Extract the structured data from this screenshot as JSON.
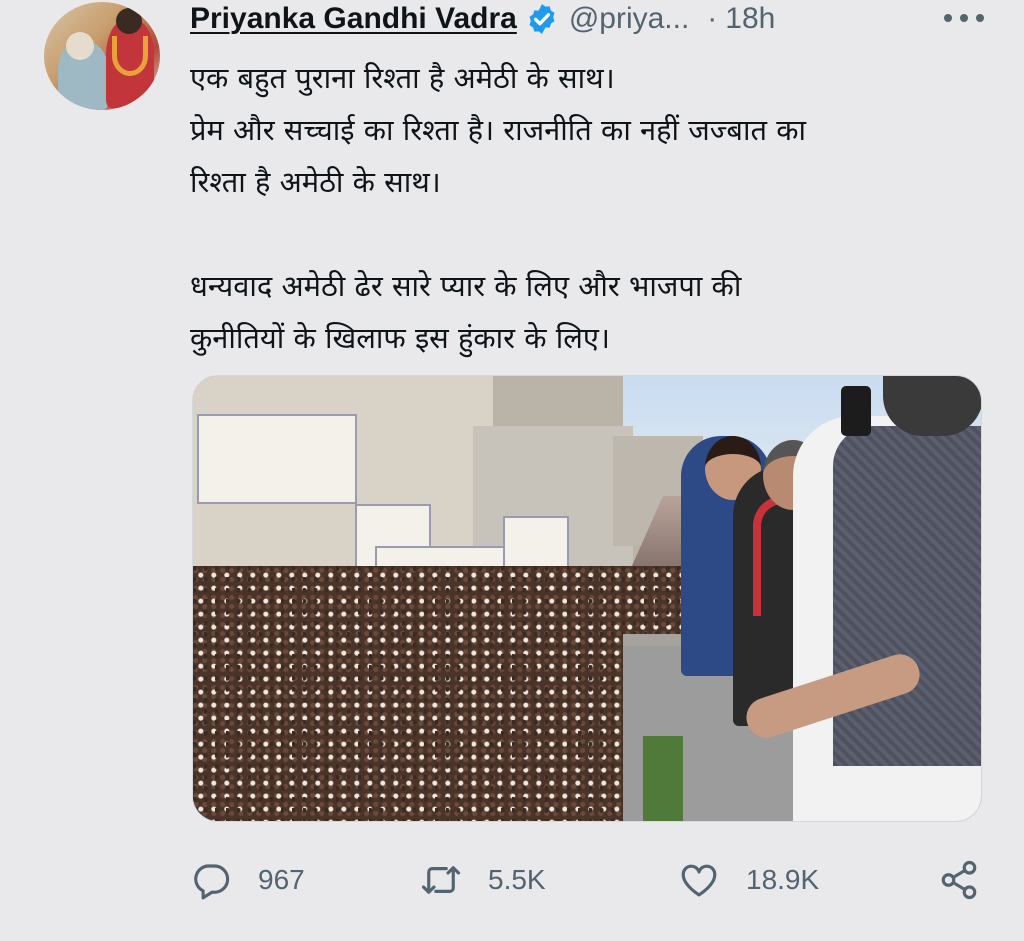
{
  "author": {
    "name": "Priyanka Gandhi Vadra",
    "handle": "@priya...",
    "separator": "·",
    "time": "18h",
    "verified": true
  },
  "tweet_text": {
    "line1": "एक बहुत पुराना रिश्ता है अमेठी के साथ।",
    "line2": "प्रेम और सच्चाई का रिश्ता है। राजनीति का नहीं जज्बात का",
    "line3": "रिश्ता है अमेठी के साथ।",
    "line4": "धन्यवाद अमेठी ढेर सारे प्यार के लिए और भाजपा की",
    "line5": "कुनीतियों के खिलाफ इस हुंकार के लिए।"
  },
  "metrics": {
    "replies": "967",
    "retweets": "5.5K",
    "likes": "18.9K"
  },
  "icons": {
    "reply": "reply-icon",
    "retweet": "retweet-icon",
    "like": "heart-icon",
    "share": "share-icon",
    "more": "more-options-icon",
    "verified": "verified-badge-icon"
  },
  "colors": {
    "background": "#e9e9ec",
    "text": "#0f1419",
    "muted": "#536471",
    "verified": "#1d9bf0"
  }
}
